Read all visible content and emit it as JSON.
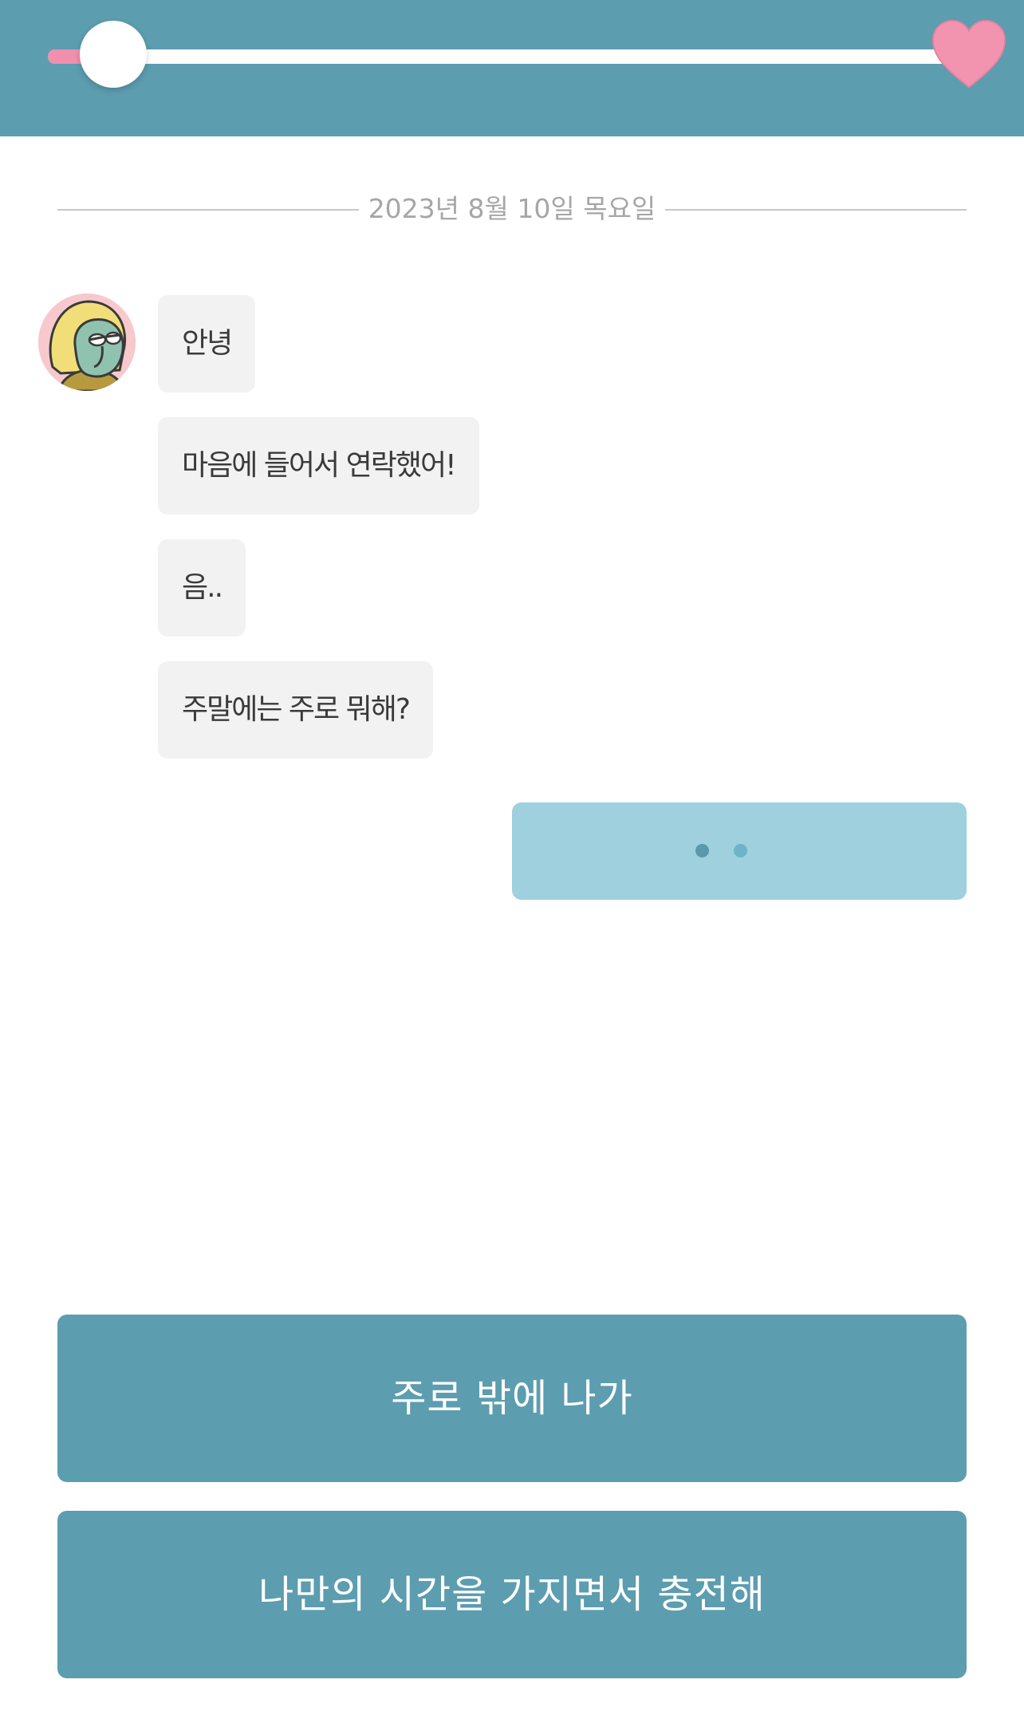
{
  "progress": {
    "value": 0.05,
    "color": "#f08fae",
    "icon": "heart-icon",
    "icon_color": "#f294b0"
  },
  "date_divider": "2023년 8월 10일 목요일",
  "chat": {
    "avatar": "character-avatar",
    "messages": [
      {
        "text": "안녕"
      },
      {
        "text": "마음에 들어서 연락했어!"
      },
      {
        "text": "음.."
      },
      {
        "text": "주말에는 주로 뭐해?"
      }
    ],
    "typing_indicator": {
      "dots": 2,
      "dot_colors": [
        "#5a98ab",
        "#6fb3c6"
      ]
    }
  },
  "choices": [
    {
      "label": "주로 밖에 나가"
    },
    {
      "label": "나만의 시간을 가지면서 충전해"
    }
  ],
  "colors": {
    "primary": "#5c9db0",
    "bubble_incoming": "#f2f2f2",
    "bubble_outgoing": "#9ed0de"
  }
}
